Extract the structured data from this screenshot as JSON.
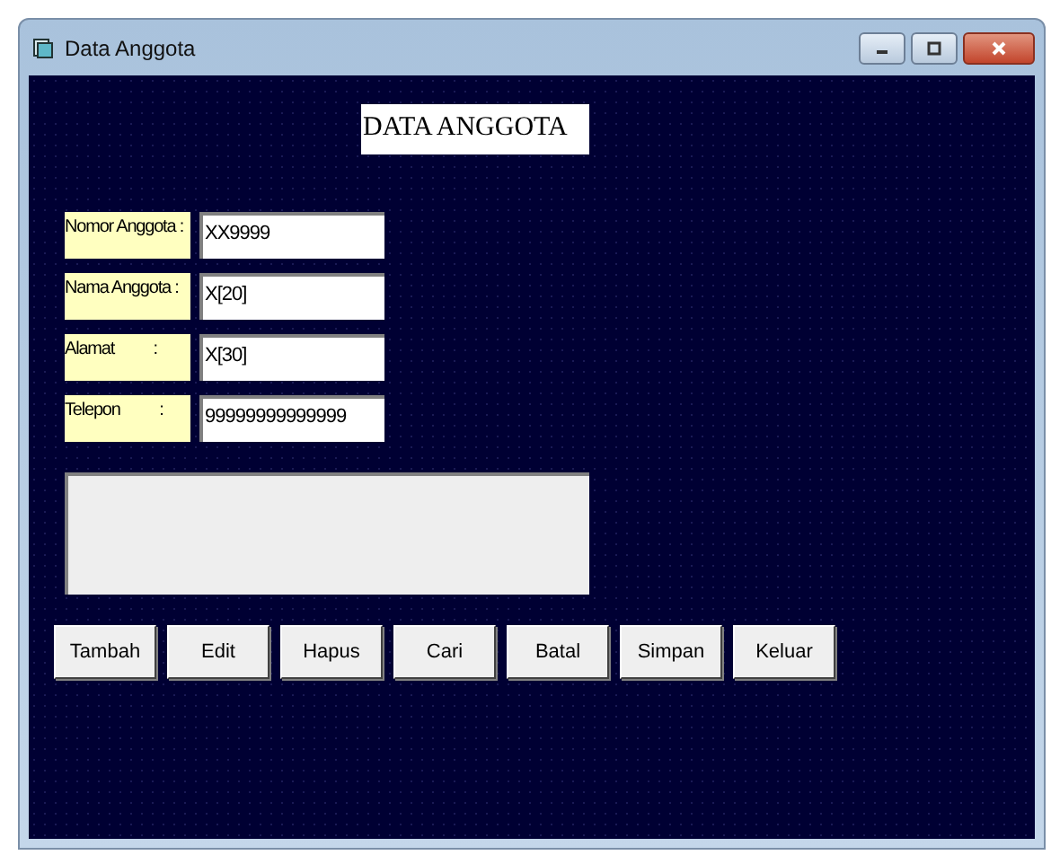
{
  "window": {
    "title": "Data Anggota"
  },
  "heading": "DATA ANGGOTA",
  "fields": [
    {
      "label": "Nomor Anggota :",
      "value": "XX9999"
    },
    {
      "label": "Nama Anggota :",
      "value": "X[20]"
    },
    {
      "label": "Alamat          :",
      "value": "X[30]"
    },
    {
      "label": "Telepon          :",
      "value": "99999999999999"
    }
  ],
  "output_box": {
    "kind": "textbox"
  },
  "buttons": [
    "Tambah",
    "Edit",
    "Hapus",
    "Cari",
    "Batal",
    "Simpan",
    "Keluar"
  ]
}
